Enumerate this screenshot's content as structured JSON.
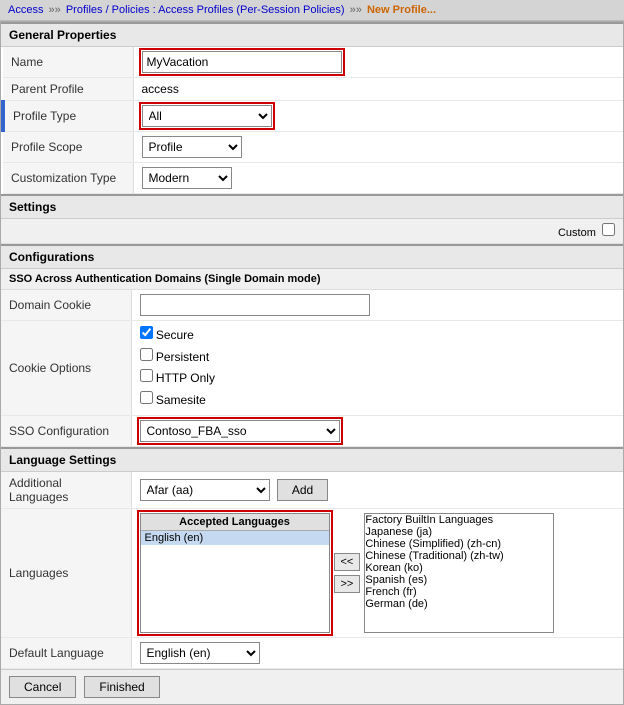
{
  "breadcrumb": {
    "parts": [
      {
        "text": "Access",
        "type": "link"
      },
      {
        "text": "»",
        "type": "separator"
      },
      {
        "text": "Profiles / Policies : Access Profiles (Per-Session Policies)",
        "type": "link"
      },
      {
        "text": "»",
        "type": "separator"
      },
      {
        "text": "New Profile...",
        "type": "current"
      }
    ]
  },
  "sections": {
    "generalProperties": "General Properties",
    "settings": "Settings",
    "configurations": "Configurations",
    "ssoSection": "SSO Across Authentication Domains (Single Domain mode)",
    "languageSettings": "Language Settings"
  },
  "form": {
    "name_label": "Name",
    "name_value": "MyVacation",
    "parentProfile_label": "Parent Profile",
    "parentProfile_value": "access",
    "profileType_label": "Profile Type",
    "profileType_value": "All",
    "profileScope_label": "Profile Scope",
    "profileScope_value": "Profile",
    "customizationType_label": "Customization Type",
    "customizationType_value": "Modern",
    "custom_label": "Custom",
    "domainCookie_label": "Domain Cookie",
    "domainCookie_value": "",
    "cookieOptions_label": "Cookie Options",
    "cookieOptions": [
      {
        "label": "Secure",
        "checked": true
      },
      {
        "label": "Persistent",
        "checked": false
      },
      {
        "label": "HTTP Only",
        "checked": false
      },
      {
        "label": "Samesite",
        "checked": false
      }
    ],
    "ssoConfig_label": "SSO Configuration",
    "ssoConfig_value": "Contoso_FBA_sso",
    "additionalLanguages_label": "Additional Languages",
    "additionalLanguages_dropdown": "Afar (aa)",
    "addButton": "Add",
    "languages_label": "Languages",
    "acceptedLanguagesHeader": "Accepted Languages",
    "acceptedLanguages": [
      "English (en)"
    ],
    "factoryBuiltInHeader": "Factory BuiltIn Languages",
    "factoryLanguages": [
      "Japanese (ja)",
      "Chinese (Simplified) (zh-cn)",
      "Chinese (Traditional) (zh-tw)",
      "Korean (ko)",
      "Spanish (es)",
      "French (fr)",
      "German (de)"
    ],
    "transferLeft": "<<",
    "transferRight": ">>",
    "defaultLanguage_label": "Default Language",
    "defaultLanguage_value": "English (en)"
  },
  "footer": {
    "cancelButton": "Cancel",
    "finishedButton": "Finished"
  }
}
